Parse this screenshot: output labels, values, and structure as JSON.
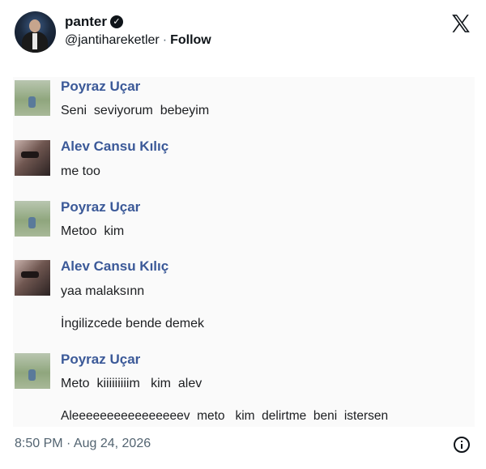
{
  "post": {
    "display_name": "panter",
    "handle": "@jantihareketler",
    "separator": "·",
    "follow_label": "Follow",
    "timestamp": "8:50 PM · Aug 24, 2026"
  },
  "icons": {
    "verified": "verified-badge-icon",
    "logo": "x-logo-icon",
    "info": "info-icon"
  },
  "chat": {
    "messages": [
      {
        "sender": "Poyraz Uçar",
        "lines": [
          "Seni  seviyorum  bebeyim"
        ]
      },
      {
        "sender": "Alev Cansu Kılıç",
        "lines": [
          "me too"
        ]
      },
      {
        "sender": "Poyraz Uçar",
        "lines": [
          "Metoo  kim"
        ]
      },
      {
        "sender": "Alev Cansu Kılıç",
        "lines": [
          "yaa malaksınn",
          "İngilizcede bende demek"
        ]
      },
      {
        "sender": "Poyraz Uçar",
        "lines": [
          "Meto  kiiiiiiiiim   kim  alev",
          "Aleeeeeeeeeeeeeeeev  meto   kim  delirtme  beni  istersen"
        ]
      }
    ]
  },
  "colors": {
    "sender_name": "#3b5998",
    "text": "#0f1419",
    "muted": "#536471"
  }
}
